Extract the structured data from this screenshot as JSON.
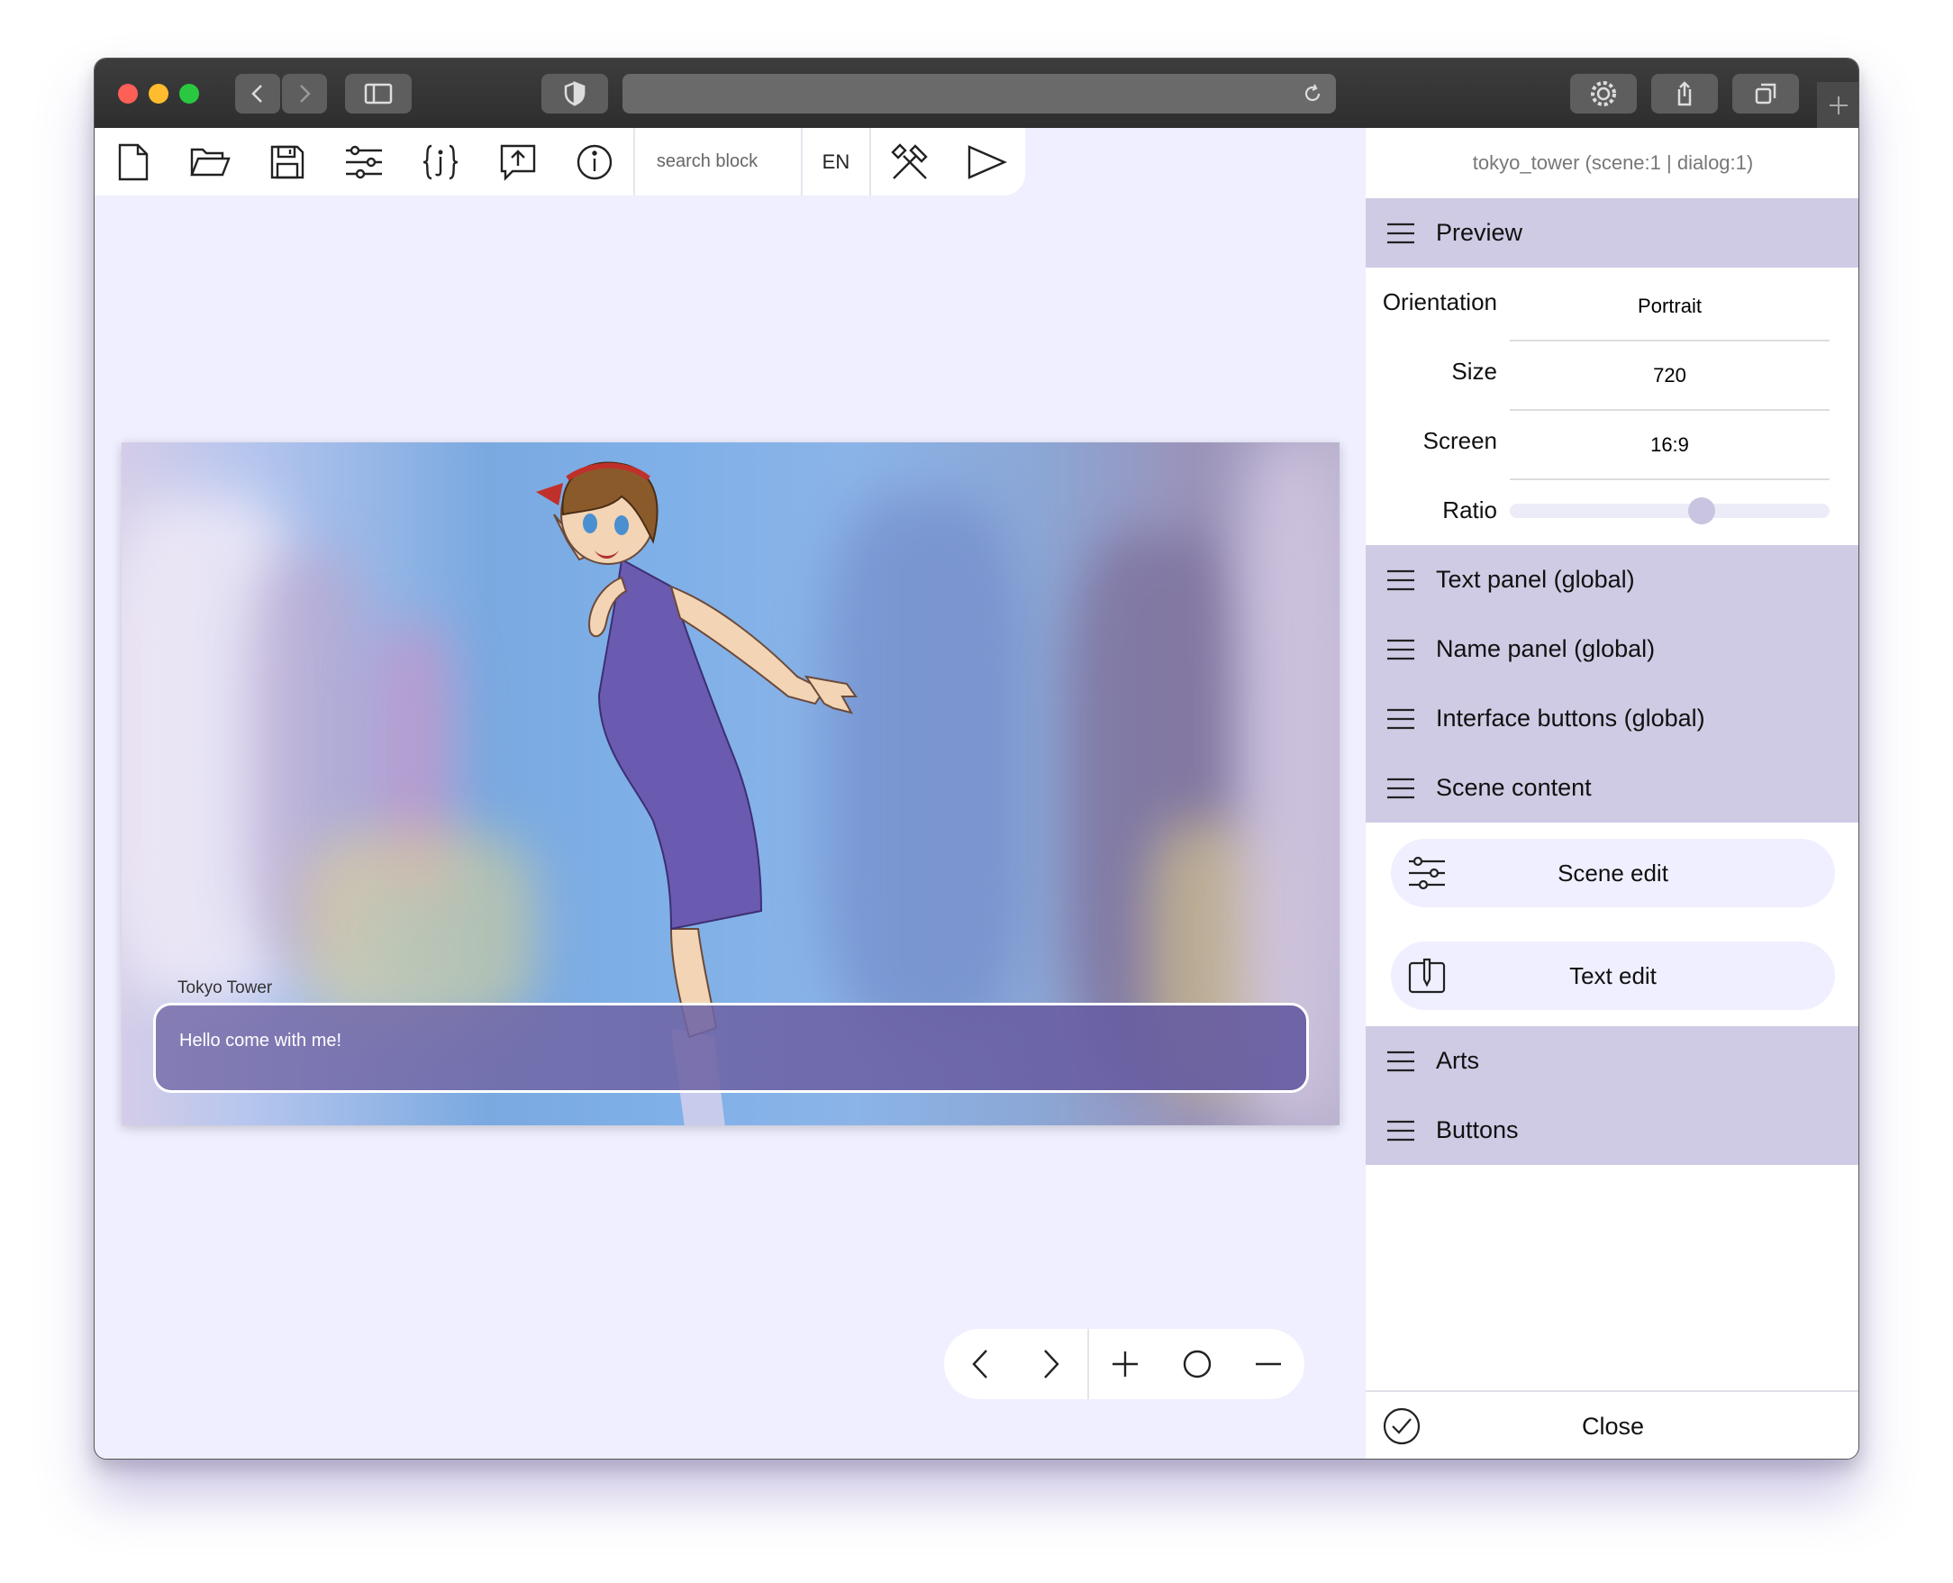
{
  "browser": {
    "traffic_colors": [
      "#fe5f57",
      "#febc2e",
      "#29c840"
    ]
  },
  "toolbar": {
    "search_placeholder": "search block",
    "language": "EN"
  },
  "stage": {
    "speaker_name": "Tokyo Tower",
    "dialog_text": "Hello come with me!"
  },
  "panel": {
    "title": "tokyo_tower (scene:1 | dialog:1)",
    "preview_label": "Preview",
    "fields": [
      {
        "label": "Orientation",
        "value": "Portrait"
      },
      {
        "label": "Size",
        "value": "720"
      },
      {
        "label": "Screen",
        "value": "16:9"
      }
    ],
    "ratio_label": "Ratio",
    "ratio_value": 0.6,
    "sections": [
      "Text panel (global)",
      "Name panel (global)",
      "Interface buttons (global)",
      "Scene content"
    ],
    "scene_edit_label": "Scene edit",
    "text_edit_label": "Text edit",
    "sections2": [
      "Arts",
      "Buttons"
    ],
    "close_label": "Close"
  },
  "colors": {
    "accent": "#cfcbe4",
    "background": "#efefff"
  }
}
